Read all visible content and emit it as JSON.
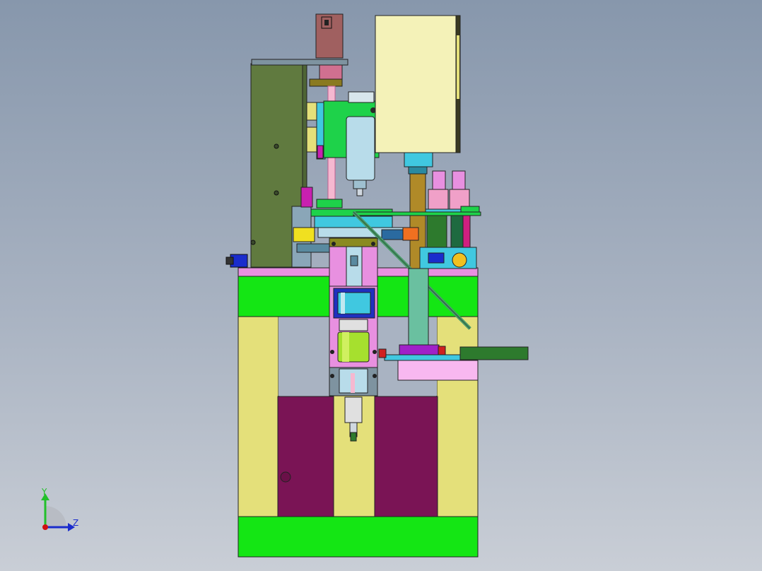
{
  "viewport": {
    "background_top": "#8797ac",
    "background_bottom": "#c9ced6"
  },
  "triad": {
    "y_label": "Y",
    "z_label": "Z",
    "y_color": "#22c02a",
    "z_color": "#1a2ccc",
    "origin_color": "#d01010"
  },
  "colors": {
    "frame_yellow": "#e4e07a",
    "base_green": "#14e614",
    "maroon": "#7a1455",
    "pink": "#e890e0",
    "motor_brown": "#a06060",
    "cabinet_cream": "#f4f2b8",
    "plate_olive": "#607a3f",
    "block_green": "#1ed24a",
    "spindle_blue": "#b8dcea",
    "rod_gold": "#b08a28",
    "slider_green": "#2d7a2d",
    "cylinder_lime": "#a6e02e",
    "cyan_block": "#40c8e0",
    "purple": "#a020c8"
  }
}
